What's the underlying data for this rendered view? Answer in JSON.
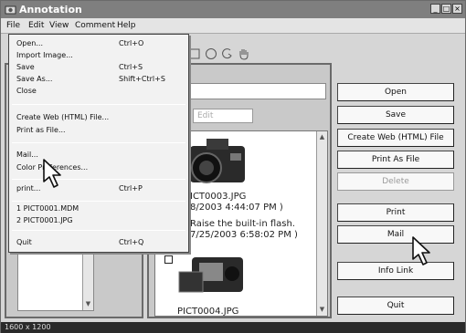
{
  "window": {
    "title": "Annotation",
    "controls": [
      "_",
      "□",
      "×"
    ]
  },
  "menubar": {
    "file": "File",
    "edit": "Edit",
    "view": "View",
    "comment": "Comment",
    "help": "Help"
  },
  "file_menu": {
    "items": [
      {
        "label": "Open...",
        "shortcut": "Ctrl+O"
      },
      {
        "label": "Import Image...",
        "shortcut": ""
      },
      {
        "label": "Save",
        "shortcut": "Ctrl+S"
      },
      {
        "label": "Save As...",
        "shortcut": "Shift+Ctrl+S"
      },
      {
        "label": "Close",
        "shortcut": ""
      },
      {
        "label": "Create Web (HTML) File...",
        "shortcut": ""
      },
      {
        "label": "Print as File...",
        "shortcut": ""
      },
      {
        "label": "Mail...",
        "shortcut": ""
      },
      {
        "label": "Color Preferences...",
        "shortcut": ""
      },
      {
        "label": "print...",
        "shortcut": "Ctrl+P"
      },
      {
        "label": "1 PICT0001.MDM",
        "shortcut": ""
      },
      {
        "label": "2 PICT0001.JPG",
        "shortcut": ""
      },
      {
        "label": "Quit",
        "shortcut": "Ctrl+Q"
      }
    ]
  },
  "middle": {
    "edit_label": "Edit",
    "photos": [
      {
        "filename": "PICT0003.JPG",
        "date": "(8/18/2003 4:44:07 PM )",
        "comment": "Raise the built-in flash.",
        "comment_date": "( 7/25/2003 6:58:02 PM )"
      },
      {
        "filename": "PICT0004.JPG"
      }
    ],
    "first_filename_visible": "ICT0003.JPG",
    "first_date_visible": "8/2003 4:44:07 PM )",
    "comment_visible": "Raise the built-in flash.",
    "comment_date_visible": "7/25/2003 6:58:02 PM )"
  },
  "buttons": {
    "open": "Open",
    "save": "Save",
    "create_web": "Create Web (HTML) File",
    "print_as_file": "Print As File",
    "delete": "Delete",
    "print": "Print",
    "mail": "Mail",
    "info_link": "Info Link",
    "quit": "Quit"
  },
  "statusbar": {
    "text": "1600 x 1200"
  }
}
